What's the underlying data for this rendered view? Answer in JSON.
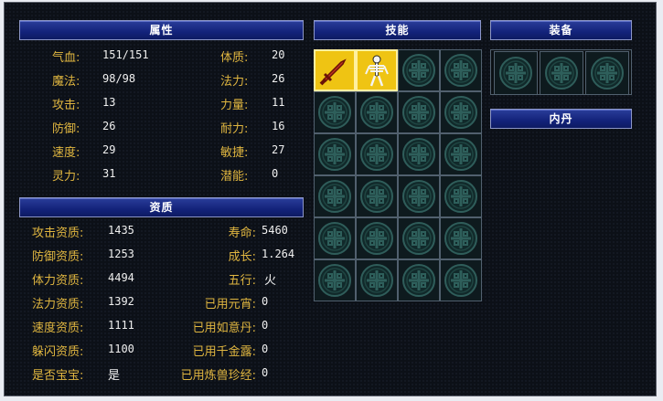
{
  "headers": {
    "attributes": "属性",
    "aptitude": "资质",
    "skills": "技能",
    "equipment": "装备",
    "inner_pill": "内丹"
  },
  "attributes": {
    "left": [
      {
        "label": "气血:",
        "value": "151/151"
      },
      {
        "label": "魔法:",
        "value": "98/98"
      },
      {
        "label": "攻击:",
        "value": "13"
      },
      {
        "label": "防御:",
        "value": "26"
      },
      {
        "label": "速度:",
        "value": "29"
      },
      {
        "label": "灵力:",
        "value": "31"
      }
    ],
    "right": [
      {
        "label": "体质:",
        "value": "20"
      },
      {
        "label": "法力:",
        "value": "26"
      },
      {
        "label": "力量:",
        "value": "11"
      },
      {
        "label": "耐力:",
        "value": "16"
      },
      {
        "label": "敏捷:",
        "value": "27"
      },
      {
        "label": "潜能:",
        "value": "0"
      }
    ]
  },
  "aptitude": {
    "left": [
      {
        "label": "攻击资质:",
        "value": "1435"
      },
      {
        "label": "防御资质:",
        "value": "1253"
      },
      {
        "label": "体力资质:",
        "value": "4494"
      },
      {
        "label": "法力资质:",
        "value": "1392"
      },
      {
        "label": "速度资质:",
        "value": "1111"
      },
      {
        "label": "躲闪资质:",
        "value": "1100"
      },
      {
        "label": "是否宝宝:",
        "value": "是"
      }
    ],
    "right": [
      {
        "label": "寿命:",
        "value": "5460"
      },
      {
        "label": "成长:",
        "value": "1.264"
      },
      {
        "label": "五行:",
        "value": "火"
      },
      {
        "label": "已用元宵:",
        "value": "0"
      },
      {
        "label": "已用如意丹:",
        "value": "0"
      },
      {
        "label": "已用千金露:",
        "value": "0"
      },
      {
        "label": "已用炼兽珍经:",
        "value": "0"
      }
    ]
  },
  "skills": {
    "slots": [
      {
        "icon": "sword-skill-icon",
        "filled": true
      },
      {
        "icon": "skeleton-skill-icon",
        "filled": true
      },
      {
        "icon": "empty-slot-emblem-icon",
        "filled": false
      }
    ],
    "total_slots": 24,
    "filled_color": "#efc413"
  },
  "equipment": {
    "total_slots": 3,
    "icon": "empty-slot-emblem-icon"
  }
}
